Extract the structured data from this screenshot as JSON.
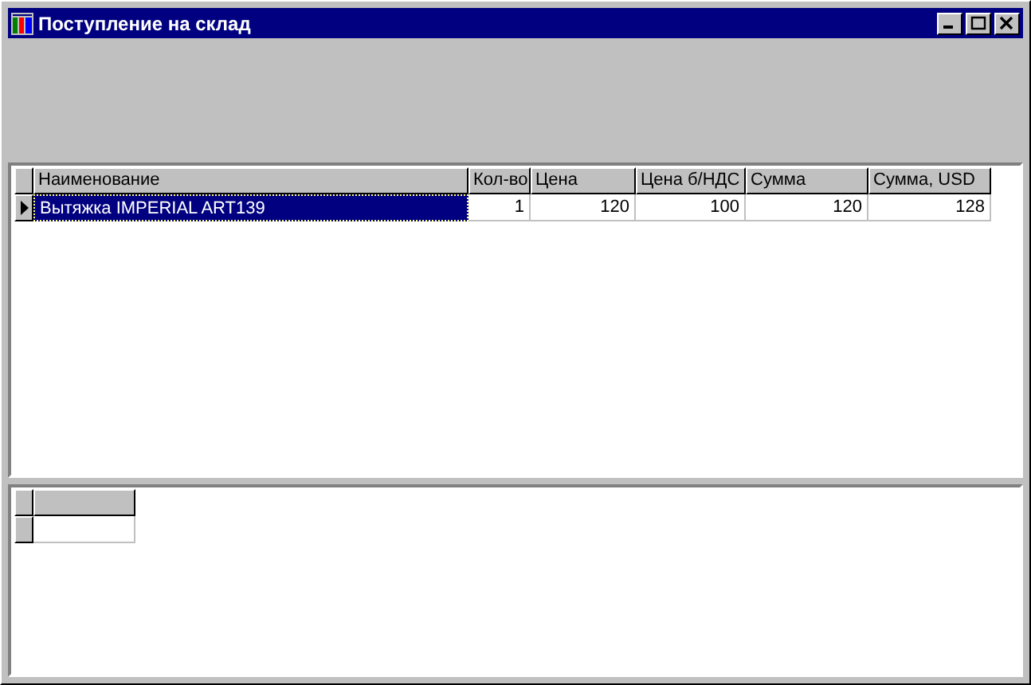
{
  "window": {
    "title": "Поступление на склад"
  },
  "grid": {
    "columns": [
      "Наименование",
      "Кол-во",
      "Цена",
      "Цена б/НДС",
      "Сумма",
      "Сумма, USD"
    ],
    "rows": [
      {
        "selected": true,
        "cells": [
          "Вытяжка IMPERIAL ART139",
          "1",
          "120",
          "100",
          "120",
          "128"
        ]
      }
    ]
  }
}
